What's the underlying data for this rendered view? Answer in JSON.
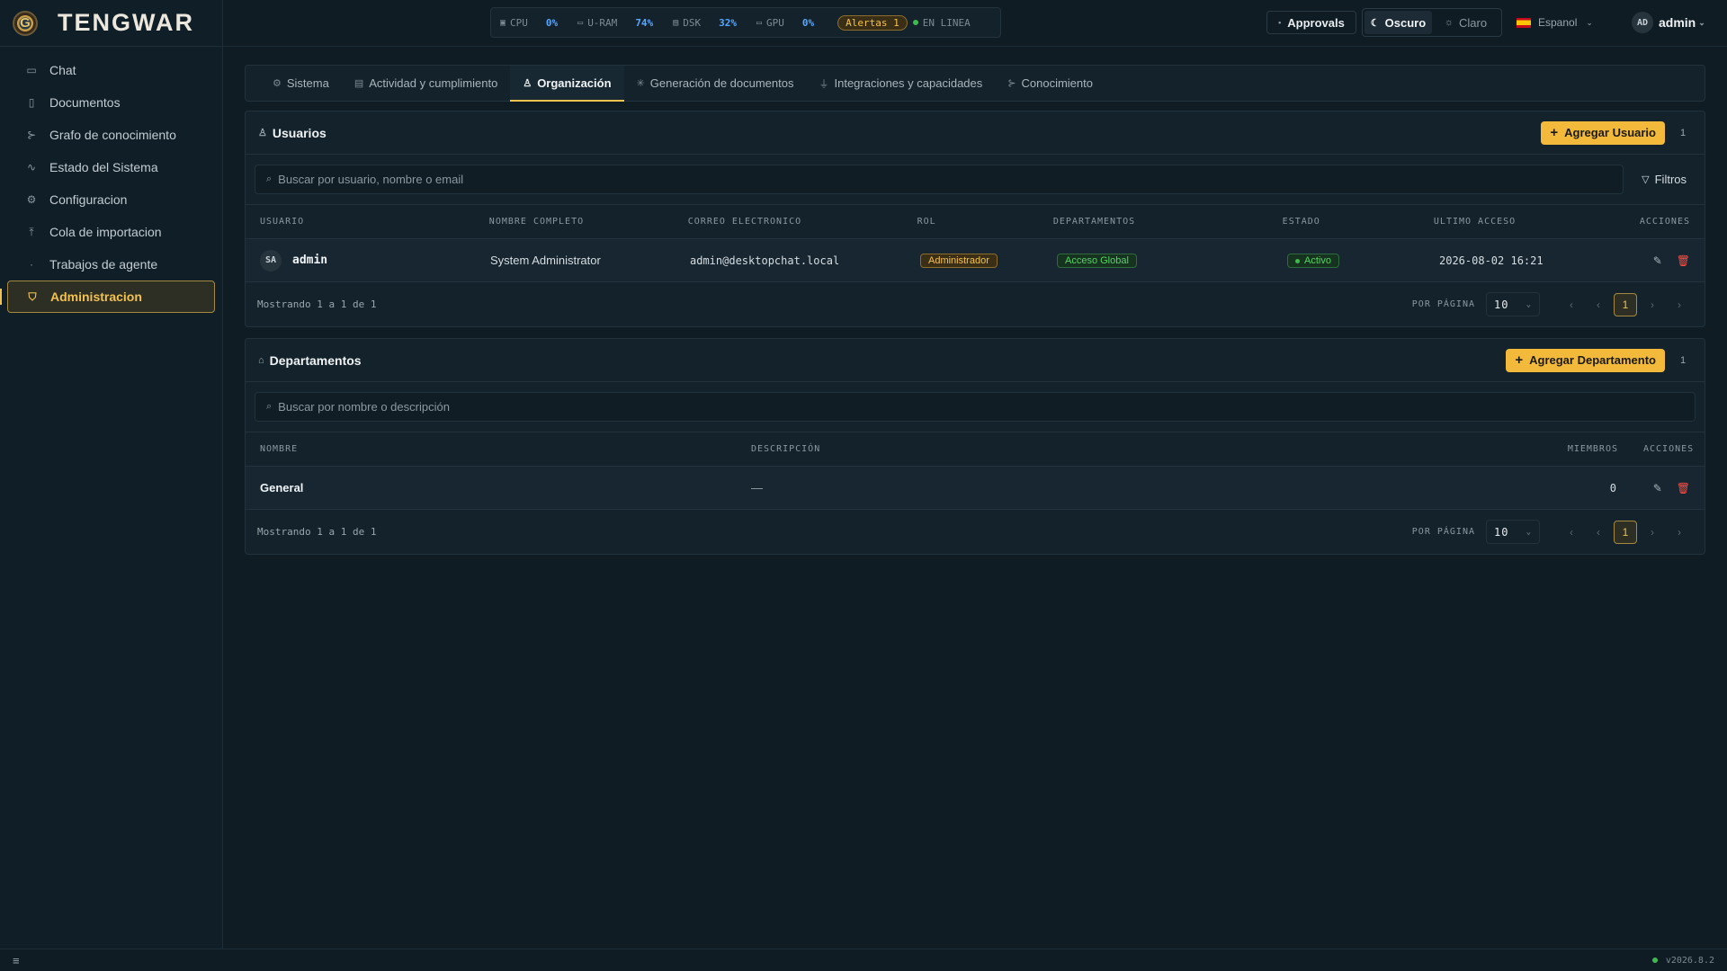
{
  "brand": {
    "logo_letter": "G",
    "name": "TENGWAR"
  },
  "sidebar": {
    "items": [
      {
        "label": "Chat",
        "icon": "chat-icon"
      },
      {
        "label": "Documentos",
        "icon": "document-icon"
      },
      {
        "label": "Grafo de conocimiento",
        "icon": "graph-icon"
      },
      {
        "label": "Estado del Sistema",
        "icon": "activity-icon"
      },
      {
        "label": "Configuracion",
        "icon": "gear-icon"
      },
      {
        "label": "Cola de importacion",
        "icon": "upload-icon"
      },
      {
        "label": "Trabajos de agente",
        "icon": "dot-icon"
      },
      {
        "label": "Administracion",
        "icon": "shield-icon",
        "active": true
      }
    ]
  },
  "topbar": {
    "metrics": [
      {
        "label": "CPU",
        "value": "0%"
      },
      {
        "label": "U-RAM",
        "value": "74%"
      },
      {
        "label": "DSK",
        "value": "32%"
      },
      {
        "label": "GPU",
        "value": "0%"
      }
    ],
    "alerts": "Alertas 1",
    "online": "EN LINEA",
    "approvals": "Approvals",
    "theme_dark": "Oscuro",
    "theme_light": "Claro",
    "language": "Espanol",
    "user_initials": "AD",
    "user_name": "admin"
  },
  "tabs": [
    {
      "label": "Sistema"
    },
    {
      "label": "Actividad y cumplimiento"
    },
    {
      "label": "Organización",
      "active": true
    },
    {
      "label": "Generación de documentos"
    },
    {
      "label": "Integraciones y capacidades"
    },
    {
      "label": "Conocimiento"
    }
  ],
  "users": {
    "title": "Usuarios",
    "add_label": "Agregar Usuario",
    "count": "1",
    "search_placeholder": "Buscar por usuario, nombre o email",
    "filters_label": "Filtros",
    "columns": [
      "USUARIO",
      "NOMBRE COMPLETO",
      "CORREO ELECTRONICO",
      "ROL",
      "DEPARTAMENTOS",
      "ESTADO",
      "ULTIMO ACCESO",
      "ACCIONES"
    ],
    "rows": [
      {
        "initials": "SA",
        "username": "admin",
        "full_name": "System Administrator",
        "email": "admin@desktopchat.local",
        "role": "Administrador",
        "department": "Acceso Global",
        "status": "Activo",
        "last_access": "2026-08-02 16:21"
      }
    ],
    "showing": "Mostrando 1 a 1 de 1",
    "per_page_label": "POR PÁGINA",
    "per_page": "10",
    "page": "1"
  },
  "departments": {
    "title": "Departamentos",
    "add_label": "Agregar Departamento",
    "count": "1",
    "search_placeholder": "Buscar por nombre o descripción",
    "columns": [
      "NOMBRE",
      "DESCRIPCIÓN",
      "MIEMBROS",
      "ACCIONES"
    ],
    "rows": [
      {
        "name": "General",
        "description": "—",
        "members": "0"
      }
    ],
    "showing": "Mostrando 1 a 1 de 1",
    "per_page_label": "POR PÁGINA",
    "per_page": "10",
    "page": "1"
  },
  "statusbar": {
    "version": "v2026.8.2"
  }
}
